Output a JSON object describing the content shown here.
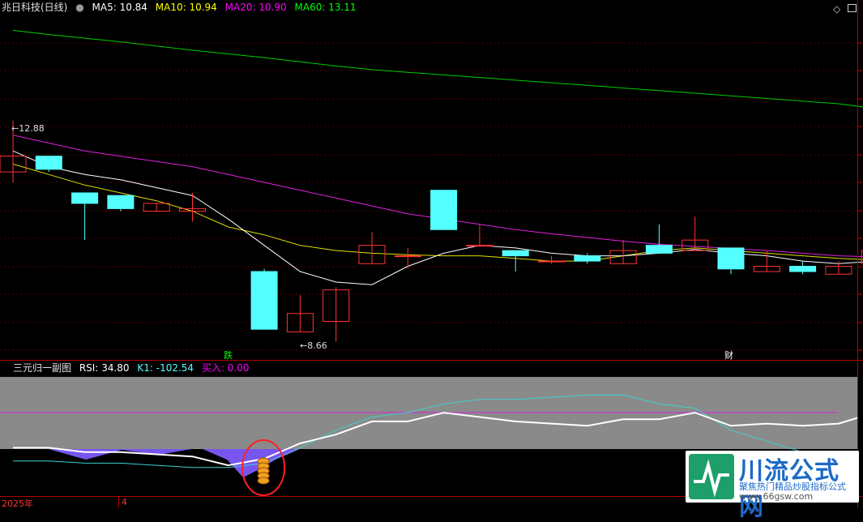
{
  "header": {
    "title": "兆日科技(日线)",
    "ma5": "MA5: 10.84",
    "ma10": "MA10: 10.94",
    "ma20": "MA20: 10.90",
    "ma60": "MA60: 13.11",
    "colors": {
      "title": "#e0e0e0",
      "ma5": "#ffffff",
      "ma10": "#ffff00",
      "ma20": "#ff00ff",
      "ma60": "#00ff00"
    }
  },
  "window_controls": {
    "diamond_icon": "diamond-icon",
    "maximize_icon": "maximize-icon"
  },
  "annotations": {
    "high_label": "12.88",
    "low_label": "8.66",
    "marker_die": "跌",
    "marker_cai": "财"
  },
  "sub_header": {
    "title": "三元归一副图",
    "rsi": "RSI: 34.80",
    "k1": "K1: -102.54",
    "buy": "买入: 0.00"
  },
  "timeline": {
    "year": "2025年",
    "month": "4"
  },
  "watermark": {
    "title": "川流公式网",
    "subtitle": "聚焦热门精品炒股指标公式",
    "url": "www.66gsw.com",
    "tiled_text": "川流公式网"
  },
  "colors": {
    "up_candle": "#ff3232",
    "down_candle": "#54ffff",
    "grid": "#5a0000",
    "frame": "#b00000",
    "band": "#8a8a8a"
  },
  "chart_data": {
    "type": "candlestick",
    "price_range": [
      8.66,
      12.88
    ],
    "candles": [
      {
        "open": 11.9,
        "close": 12.2,
        "high": 12.88,
        "low": 11.7
      },
      {
        "open": 12.2,
        "close": 11.95,
        "high": 12.2,
        "low": 11.9
      },
      {
        "open": 11.5,
        "close": 11.3,
        "high": 11.5,
        "low": 10.6
      },
      {
        "open": 11.45,
        "close": 11.2,
        "high": 11.45,
        "low": 11.15
      },
      {
        "open": 11.15,
        "close": 11.3,
        "high": 11.3,
        "low": 11.15
      },
      {
        "open": 11.15,
        "close": 11.2,
        "high": 11.5,
        "low": 10.95
      },
      {
        "open": null,
        "close": null,
        "high": null,
        "low": null
      },
      {
        "open": 10.0,
        "close": 8.9,
        "high": 10.05,
        "low": 8.9
      },
      {
        "open": 8.85,
        "close": 9.2,
        "high": 9.55,
        "low": 8.85
      },
      {
        "open": 9.05,
        "close": 9.65,
        "high": 9.7,
        "low": 8.66
      },
      {
        "open": 10.15,
        "close": 10.5,
        "high": 10.75,
        "low": 10.15
      },
      {
        "open": 10.3,
        "close": 10.3,
        "high": 10.45,
        "low": 10.05
      },
      {
        "open": 11.55,
        "close": 10.8,
        "high": 11.55,
        "low": 10.8
      },
      {
        "open": 10.5,
        "close": 10.5,
        "high": 10.9,
        "low": 10.5
      },
      {
        "open": 10.4,
        "close": 10.3,
        "high": 10.4,
        "low": 10.0
      },
      {
        "open": 10.2,
        "close": 10.2,
        "high": 10.3,
        "low": 10.15
      },
      {
        "open": 10.3,
        "close": 10.2,
        "high": 10.35,
        "low": 10.15
      },
      {
        "open": 10.15,
        "close": 10.4,
        "high": 10.6,
        "low": 10.15
      },
      {
        "open": 10.5,
        "close": 10.35,
        "high": 10.9,
        "low": 10.35
      },
      {
        "open": 10.4,
        "close": 10.6,
        "high": 11.05,
        "low": 10.4
      },
      {
        "open": 10.45,
        "close": 10.05,
        "high": 10.45,
        "low": 9.95
      },
      {
        "open": 10.0,
        "close": 10.1,
        "high": 10.4,
        "low": 10.0
      },
      {
        "open": 10.1,
        "close": 10.0,
        "high": 10.2,
        "low": 9.95
      },
      {
        "open": 9.95,
        "close": 10.1,
        "high": 10.2,
        "low": 9.95
      },
      {
        "open": 10.15,
        "close": 10.4,
        "high": 10.5,
        "low": 10.15
      }
    ],
    "ma5": [
      12.3,
      12.0,
      11.85,
      11.75,
      11.6,
      11.45,
      11.0,
      10.5,
      10.0,
      9.8,
      9.75,
      10.1,
      10.35,
      10.5,
      10.45,
      10.35,
      10.3,
      10.3,
      10.35,
      10.42,
      10.35,
      10.3,
      10.2,
      10.15,
      10.2
    ],
    "ma10": [
      12.05,
      11.85,
      11.65,
      11.5,
      11.35,
      11.15,
      10.85,
      10.7,
      10.5,
      10.4,
      10.35,
      10.32,
      10.3,
      10.3,
      10.25,
      10.2,
      10.2,
      10.3,
      10.4,
      10.45,
      10.4,
      10.35,
      10.3,
      10.25,
      10.22
    ],
    "ma20": [
      12.6,
      12.45,
      12.3,
      12.2,
      12.1,
      12.0,
      11.85,
      11.7,
      11.55,
      11.4,
      11.25,
      11.1,
      11.0,
      10.9,
      10.8,
      10.72,
      10.65,
      10.58,
      10.52,
      10.48,
      10.44,
      10.4,
      10.35,
      10.3,
      10.28
    ],
    "ma60": [
      14.6,
      14.52,
      14.45,
      14.38,
      14.3,
      14.22,
      14.15,
      14.08,
      14.0,
      13.92,
      13.85,
      13.8,
      13.75,
      13.7,
      13.65,
      13.6,
      13.55,
      13.5,
      13.45,
      13.4,
      13.35,
      13.3,
      13.25,
      13.2,
      13.11
    ],
    "sub": {
      "rsi_white": [
        42,
        42,
        40,
        40,
        39,
        38,
        34,
        37,
        44,
        48,
        54,
        54,
        58,
        56,
        54,
        53,
        52,
        55,
        55,
        58,
        52,
        53,
        52,
        53,
        58
      ],
      "k1_cyan": [
        36,
        36,
        35,
        35,
        34,
        33,
        33,
        35,
        42,
        50,
        56,
        58,
        62,
        64,
        64,
        65,
        66,
        66,
        62,
        60,
        50,
        45,
        40,
        38,
        42
      ],
      "buy_signal_index": 7
    }
  }
}
